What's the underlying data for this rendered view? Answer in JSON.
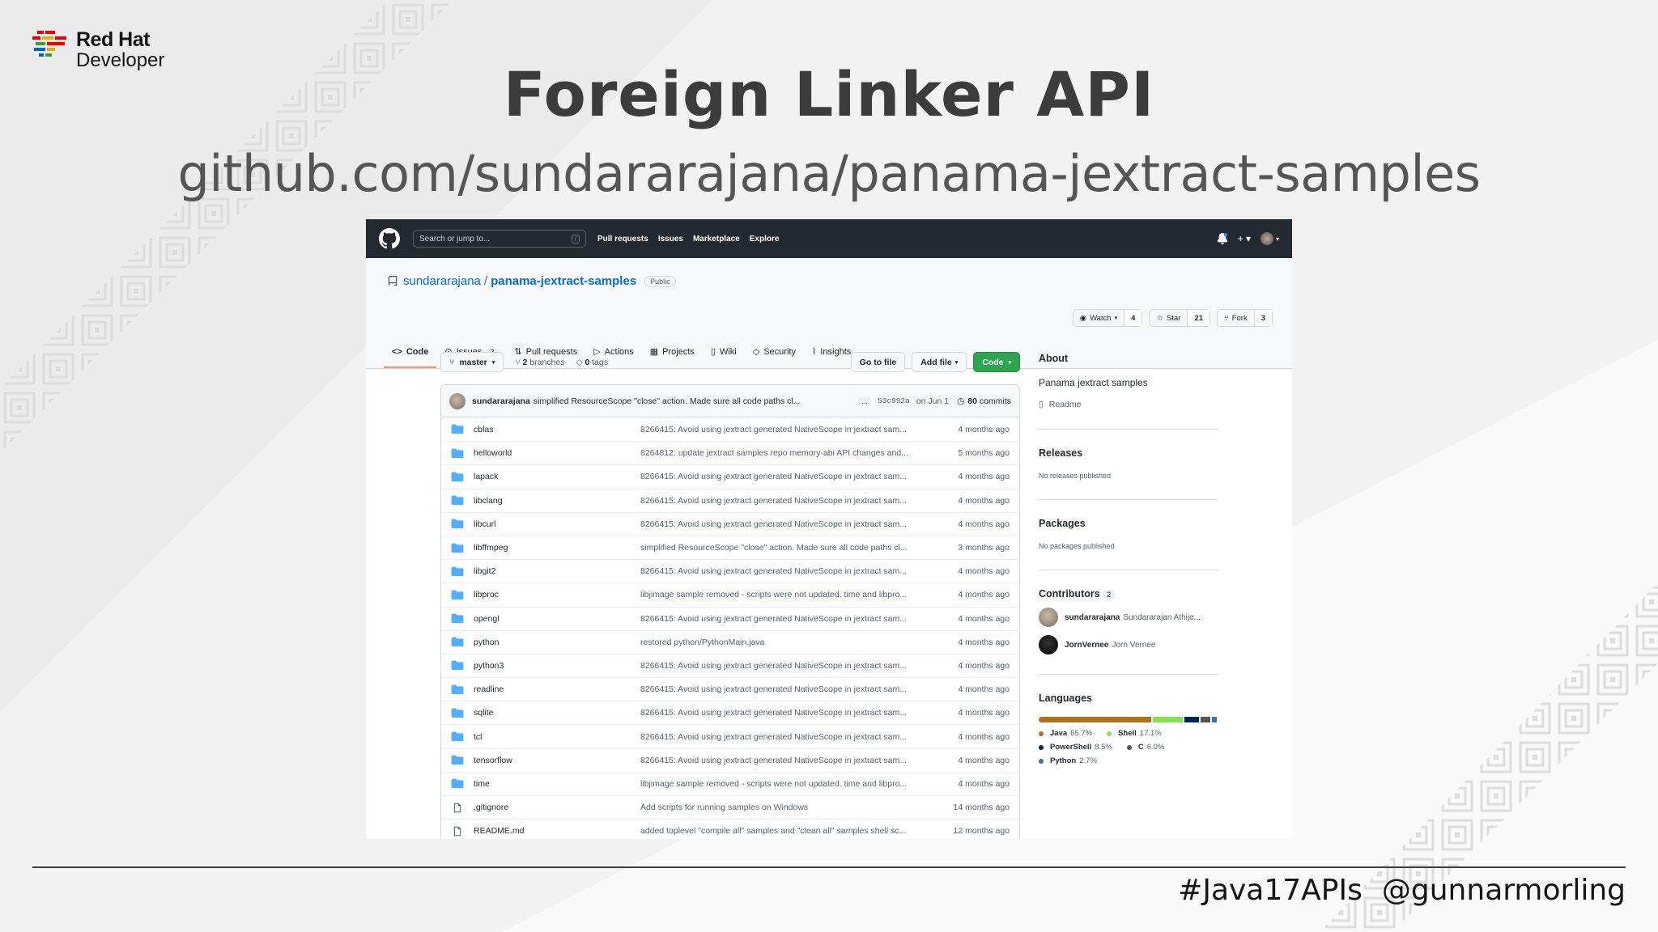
{
  "slide": {
    "logo_line1": "Red Hat",
    "logo_line2": "Developer",
    "title": "Foreign Linker API",
    "subtitle": "github.com/sundararajana/panama-jextract-samples",
    "footer_hashtag": "#Java17APIs",
    "footer_handle": "@gunnarmorling"
  },
  "gh": {
    "search_placeholder": "Search or jump to...",
    "search_key": "/",
    "nav": [
      "Pull requests",
      "Issues",
      "Marketplace",
      "Explore"
    ],
    "plus": "+ ▾",
    "repo": {
      "owner": "sundararajana",
      "separator": "/",
      "name": "panama-jextract-samples",
      "visibility": "Public",
      "watch_label": "Watch",
      "watch_count": "4",
      "star_label": "Star",
      "star_count": "21",
      "fork_label": "Fork",
      "fork_count": "3"
    },
    "tabs": {
      "code": "Code",
      "issues": "Issues",
      "issues_count": "2",
      "pulls": "Pull requests",
      "actions": "Actions",
      "projects": "Projects",
      "wiki": "Wiki",
      "security": "Security",
      "insights": "Insights"
    },
    "branch": "master",
    "branches_count": "2",
    "branches_label": "branches",
    "tags_count": "0",
    "tags_label": "tags",
    "goto_file": "Go to file",
    "add_file": "Add file",
    "code_btn": "Code",
    "commit": {
      "user": "sundararajana",
      "message": "simplified ResourceScope \"close\" action. Made sure all code paths cl...",
      "ellipsis": "...",
      "sha": "53c992a",
      "date": "on Jun 1",
      "count": "80",
      "count_label": "commits"
    },
    "files": [
      {
        "name": "cblas",
        "type": "dir",
        "msg": "8266415: Avoid using jextract generated NativeScope in jextract sam...",
        "age": "4 months ago"
      },
      {
        "name": "helloworld",
        "type": "dir",
        "msg": "8264812: update jextract samples repo memory-abi API changes and...",
        "age": "5 months ago"
      },
      {
        "name": "lapack",
        "type": "dir",
        "msg": "8266415: Avoid using jextract generated NativeScope in jextract sam...",
        "age": "4 months ago"
      },
      {
        "name": "libclang",
        "type": "dir",
        "msg": "8266415: Avoid using jextract generated NativeScope in jextract sam...",
        "age": "4 months ago"
      },
      {
        "name": "libcurl",
        "type": "dir",
        "msg": "8266415: Avoid using jextract generated NativeScope in jextract sam...",
        "age": "4 months ago"
      },
      {
        "name": "libffmpeg",
        "type": "dir",
        "msg": "simplified ResourceScope \"close\" action. Made sure all code paths cl...",
        "age": "3 months ago"
      },
      {
        "name": "libgit2",
        "type": "dir",
        "msg": "8266415: Avoid using jextract generated NativeScope in jextract sam...",
        "age": "4 months ago"
      },
      {
        "name": "libproc",
        "type": "dir",
        "msg": "libjimage sample removed - scripts were not updated. time and libpro...",
        "age": "4 months ago"
      },
      {
        "name": "opengl",
        "type": "dir",
        "msg": "8266415: Avoid using jextract generated NativeScope in jextract sam...",
        "age": "4 months ago"
      },
      {
        "name": "python",
        "type": "dir",
        "msg": "restored python/PythonMain.java",
        "age": "4 months ago"
      },
      {
        "name": "python3",
        "type": "dir",
        "msg": "8266415: Avoid using jextract generated NativeScope in jextract sam...",
        "age": "4 months ago"
      },
      {
        "name": "readline",
        "type": "dir",
        "msg": "8266415: Avoid using jextract generated NativeScope in jextract sam...",
        "age": "4 months ago"
      },
      {
        "name": "sqlite",
        "type": "dir",
        "msg": "8266415: Avoid using jextract generated NativeScope in jextract sam...",
        "age": "4 months ago"
      },
      {
        "name": "tcl",
        "type": "dir",
        "msg": "8266415: Avoid using jextract generated NativeScope in jextract sam...",
        "age": "4 months ago"
      },
      {
        "name": "tensorflow",
        "type": "dir",
        "msg": "8266415: Avoid using jextract generated NativeScope in jextract sam...",
        "age": "4 months ago"
      },
      {
        "name": "time",
        "type": "dir",
        "msg": "libjimage sample removed - scripts were not updated. time and libpro...",
        "age": "4 months ago"
      },
      {
        "name": ".gitignore",
        "type": "file",
        "msg": "Add scripts for running samples on Windows",
        "age": "14 months ago"
      },
      {
        "name": "README.md",
        "type": "file",
        "msg": "added toplevel \"compile all\" samples and \"clean all\" samples shell sc...",
        "age": "12 months ago"
      }
    ],
    "sidebar": {
      "about_title": "About",
      "about_desc": "Panama jextract samples",
      "readme": "Readme",
      "releases_title": "Releases",
      "releases_note": "No releases published",
      "packages_title": "Packages",
      "packages_note": "No packages published",
      "contributors_title": "Contributors",
      "contributors_count": "2",
      "contributors": [
        {
          "login": "sundararajana",
          "name": "Sundararajan Athije..."
        },
        {
          "login": "JornVernee",
          "name": "Jorn Vernee"
        }
      ],
      "languages_title": "Languages",
      "languages": [
        {
          "name": "Java",
          "pct": "65.7%",
          "value": 65.7,
          "color": "#b07219"
        },
        {
          "name": "Shell",
          "pct": "17.1%",
          "value": 17.1,
          "color": "#89e051"
        },
        {
          "name": "PowerShell",
          "pct": "8.5%",
          "value": 8.5,
          "color": "#012456"
        },
        {
          "name": "C",
          "pct": "6.0%",
          "value": 6.0,
          "color": "#555555"
        },
        {
          "name": "Python",
          "pct": "2.7%",
          "value": 2.7,
          "color": "#3572A5"
        }
      ]
    }
  },
  "colors": {
    "brand_red": "#ee0000",
    "github_header": "#24292f",
    "link_blue": "#0969da",
    "code_green": "#2da44e",
    "folder_blue": "#54aeff"
  }
}
